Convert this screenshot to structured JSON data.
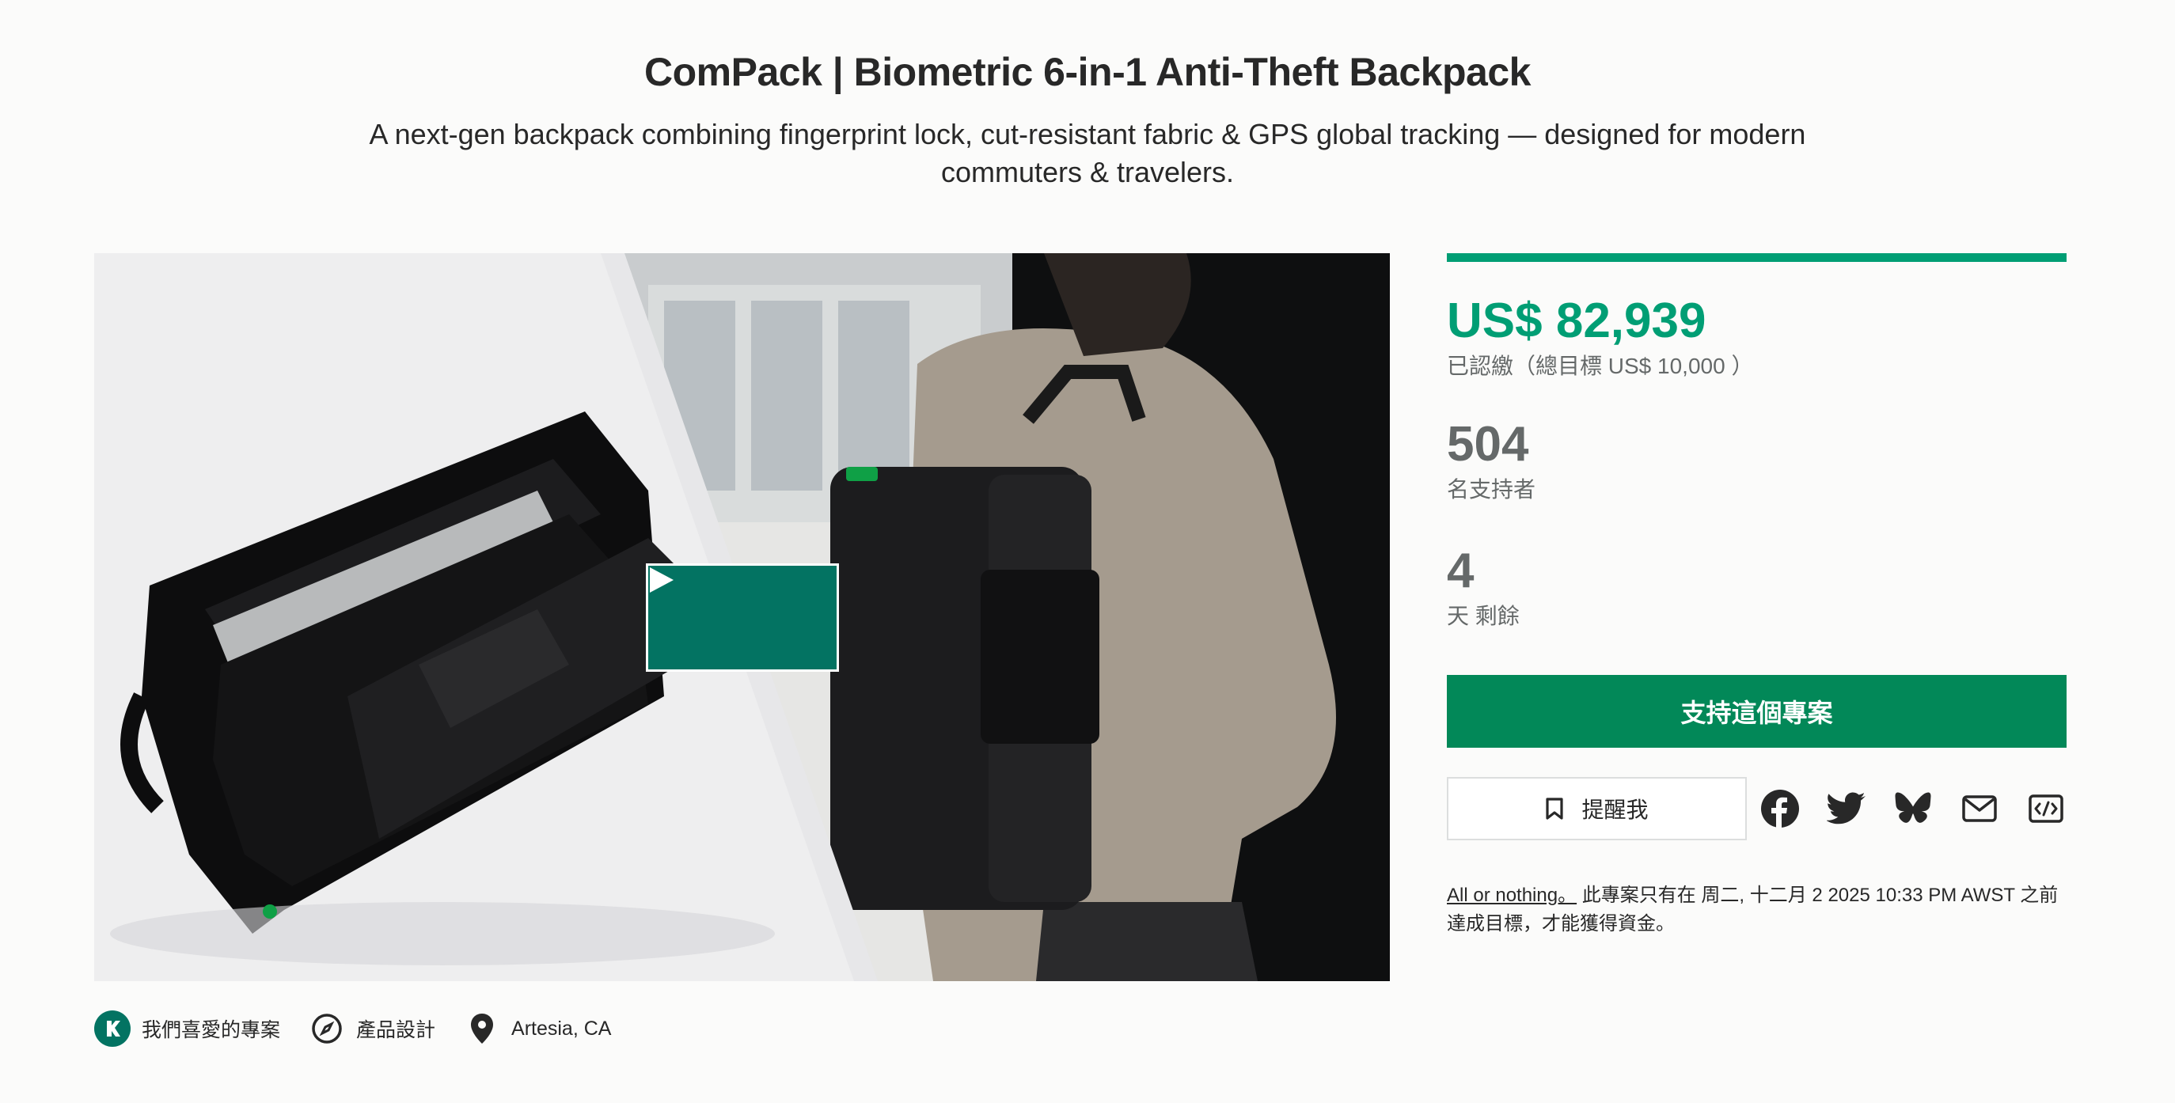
{
  "header": {
    "title": "ComPack | Biometric 6-in-1 Anti-Theft Backpack",
    "subtitle": "A next-gen backpack combining fingerprint lock, cut-resistant fabric & GPS global tracking — designed for modern commuters & travelers."
  },
  "video": {
    "play_icon": "play-icon"
  },
  "tags": {
    "project_we_love": "我們喜愛的專案",
    "category": "產品設計",
    "location": "Artesia, CA"
  },
  "stats": {
    "progress_fraction": 1.0,
    "pledged": "US$ 82,939",
    "pledged_sub": "已認繳（總目標 US$ 10,000 ）",
    "backers": "504",
    "backers_label": "名支持者",
    "days": "4",
    "days_label": "天 剩餘"
  },
  "actions": {
    "back_button": "支持這個專案",
    "remind_button": "提醒我",
    "share_icons": [
      "facebook-icon",
      "twitter-icon",
      "bluesky-icon",
      "email-icon",
      "embed-icon"
    ]
  },
  "funding": {
    "link_text": "All or nothing。",
    "text": " 此專案只有在 周二, 十二月 2 2025 10:33 PM AWST 之前達成目標，才能獲得資金。"
  },
  "colors": {
    "accent_green": "#009e74",
    "button_green": "#028858",
    "play_button": "#037362"
  }
}
